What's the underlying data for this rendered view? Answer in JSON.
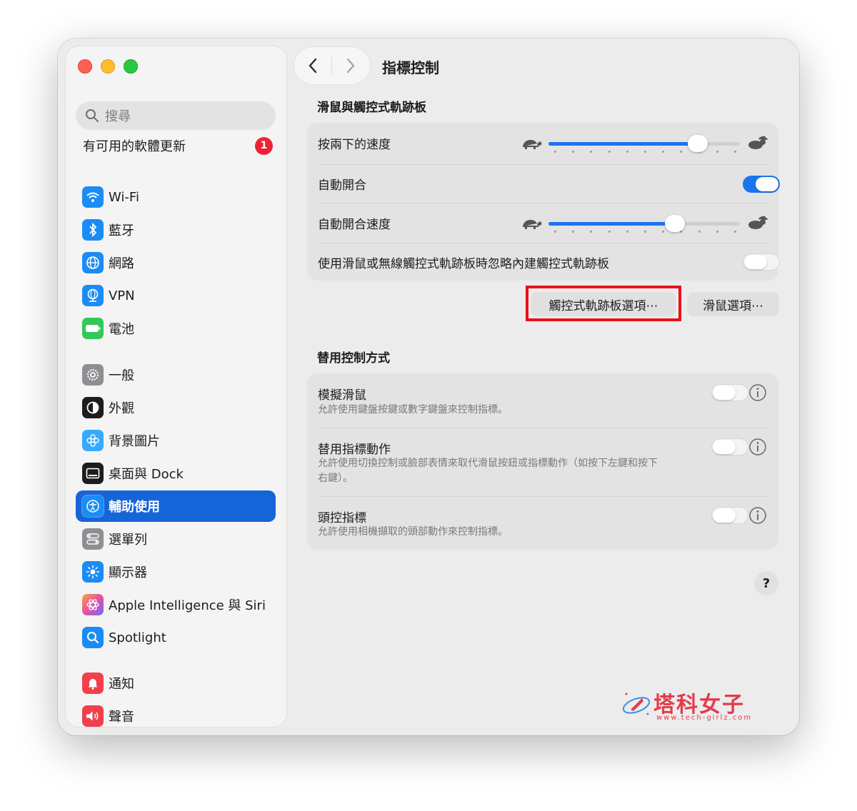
{
  "sidebar": {
    "search_placeholder": "搜尋",
    "update_label": "有可用的軟體更新",
    "update_badge": "1",
    "items": [
      {
        "label": "Wi-Fi",
        "icon": "wifi-icon",
        "color": "#1b8cf5"
      },
      {
        "label": "藍牙",
        "icon": "bluetooth-icon",
        "color": "#1b8cf5"
      },
      {
        "label": "網路",
        "icon": "globe-icon",
        "color": "#1b8cf5"
      },
      {
        "label": "VPN",
        "icon": "vpn-globe-icon",
        "color": "#1b8cf5"
      },
      {
        "label": "電池",
        "icon": "battery-icon",
        "color": "#34c759"
      },
      {
        "label": "一般",
        "icon": "gear-icon",
        "color": "#8e8e93"
      },
      {
        "label": "外觀",
        "icon": "appearance-icon",
        "color": "#1d1d1f"
      },
      {
        "label": "背景圖片",
        "icon": "wallpaper-icon",
        "color": "#35aaff"
      },
      {
        "label": "桌面與 Dock",
        "icon": "dock-icon",
        "color": "#1d1d1f"
      },
      {
        "label": "輔助使用",
        "icon": "accessibility-icon",
        "color": "#1b8cf5",
        "active": true
      },
      {
        "label": "選單列",
        "icon": "menubar-icon",
        "color": "#8e8e93"
      },
      {
        "label": "顯示器",
        "icon": "display-icon",
        "color": "#1b8cf5"
      },
      {
        "label": "Apple Intelligence 與 Siri",
        "icon": "siri-icon",
        "color": "#d36bd9"
      },
      {
        "label": "Spotlight",
        "icon": "spotlight-icon",
        "color": "#1b8cf5"
      },
      {
        "label": "通知",
        "icon": "notification-icon",
        "color": "#f1404b"
      },
      {
        "label": "聲音",
        "icon": "sound-icon",
        "color": "#f1404b"
      }
    ]
  },
  "header": {
    "back_icon": "chevron-left-icon",
    "forward_icon": "chevron-right-icon",
    "title": "指標控制"
  },
  "mouse_section": {
    "title": "滑鼠與觸控式軌跡板",
    "double_click_speed": {
      "label": "按兩下的速度",
      "value": 0.78
    },
    "spring_loading": {
      "label": "自動開合",
      "on": true
    },
    "spring_loading_speed": {
      "label": "自動開合速度",
      "value": 0.66
    },
    "ignore_builtin": {
      "label": "使用滑鼠或無線觸控式軌跡板時忽略內建觸控式軌跡板",
      "on": false
    },
    "trackpad_options_button": "觸控式軌跡板選項⋯",
    "mouse_options_button": "滑鼠選項⋯"
  },
  "alt_section": {
    "title": "替用控制方式",
    "rows": [
      {
        "label": "模擬滑鼠",
        "desc": "允許使用鍵盤按鍵或數字鍵盤來控制指標。",
        "on": false
      },
      {
        "label": "替用指標動作",
        "desc": "允許使用切換控制或臉部表情來取代滑鼠按鈕或指標動作（如按下左鍵和按下右鍵）。",
        "on": false
      },
      {
        "label": "頭控指標",
        "desc": "允許使用相機擷取的頭部動作來控制指標。",
        "on": false
      }
    ]
  },
  "help_label": "?",
  "watermark": {
    "text": "塔科女子",
    "url": "www.tech-girlz.com"
  },
  "colors": {
    "accent": "#1a74f0",
    "highlight": "#e8111b",
    "badge": "#ea2434"
  }
}
